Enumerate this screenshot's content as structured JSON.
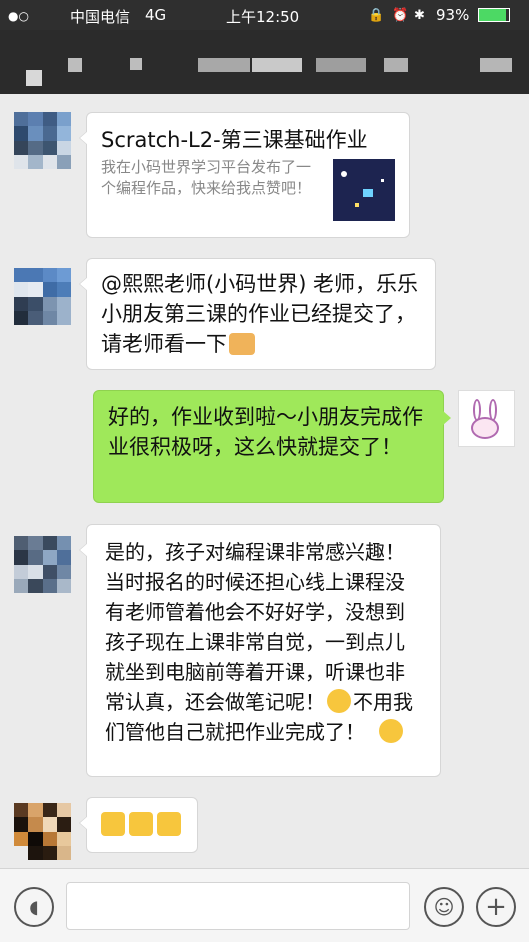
{
  "status_bar": {
    "carrier": "中国电信",
    "network": "4G",
    "time": "上午12:50",
    "battery": "93%"
  },
  "messages": [
    {
      "side": "left",
      "card_title": "Scratch-L2-第三课基础作业",
      "card_desc": "我在小码世界学习平台发布了一个编程作品，快来给我点赞吧！"
    },
    {
      "side": "left",
      "text": "@熙熙老师(小码世界) 老师，乐乐小朋友第三课的作业已经提交了，请老师看一下"
    },
    {
      "side": "right",
      "text": "好的，作业收到啦～小朋友完成作业很积极呀，这么快就提交了！"
    },
    {
      "side": "left",
      "text_a": "是的，孩子对编程课非常感兴趣！当时报名的时候还担心线上课程没有老师管着他会不好好学，没想到孩子现在上课非常自觉，一到点儿就坐到电脑前等着开课，听课也非常认真，还会做笔记呢！",
      "text_b": "不用我们管他自己就把作业完成了！"
    },
    {
      "side": "left",
      "emoji_count": 3
    }
  ],
  "icons": {
    "voice": "voice-icon",
    "emoji": "emoji-icon",
    "plus": "plus-icon"
  },
  "colors": {
    "sent_bubble": "#9fe85a",
    "received_bubble": "#ffffff",
    "background": "#ebebeb"
  }
}
